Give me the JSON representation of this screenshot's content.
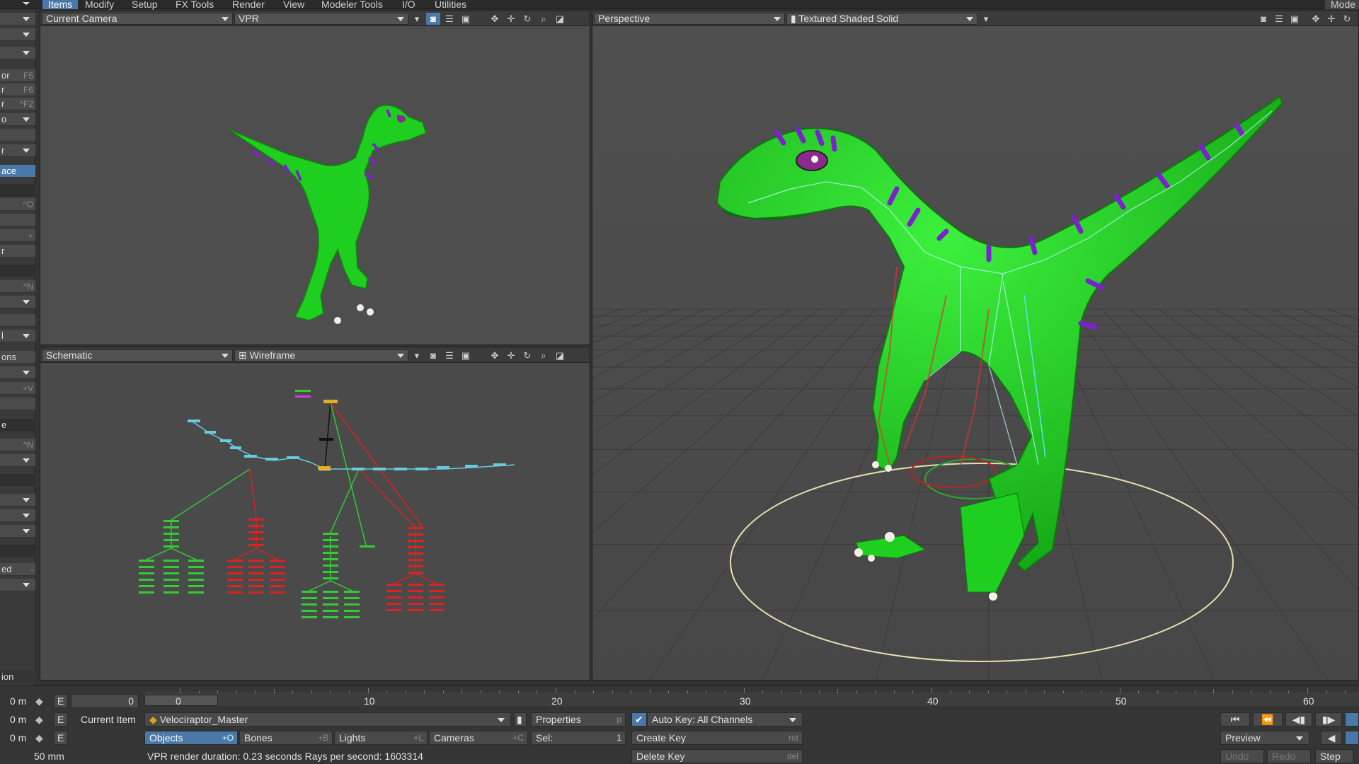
{
  "menu": {
    "tabs": [
      "Items",
      "Modify",
      "Setup",
      "FX Tools",
      "Render",
      "View",
      "Modeler Tools",
      "I/O",
      "Utilities"
    ],
    "active": "Items",
    "right_label": "Mode"
  },
  "left_toolbar": {
    "rows": [
      {
        "text": "",
        "key": ""
      },
      {
        "text": "",
        "key": ""
      },
      {
        "text": "or",
        "key": "F5"
      },
      {
        "text": "r",
        "key": "F6"
      },
      {
        "text": "r",
        "key": "^F2"
      },
      {
        "text": "o",
        "key": ""
      },
      {
        "text": "r",
        "key": ""
      },
      {
        "text": "ace",
        "key": ""
      },
      {
        "text": "",
        "key": "^O"
      },
      {
        "text": "",
        "key": "+"
      },
      {
        "text": "r",
        "key": ""
      },
      {
        "text": "",
        "key": "^N"
      },
      {
        "text": "l",
        "key": ""
      },
      {
        "text": "ons",
        "key": ""
      },
      {
        "text": "",
        "key": "+V"
      },
      {
        "text": "e",
        "key": ""
      },
      {
        "text": "",
        "key": "^N"
      },
      {
        "text": "ed",
        "key": "-"
      },
      {
        "text": "ion",
        "key": ""
      }
    ]
  },
  "vp_top_left": {
    "camera": "Current Camera",
    "renderer": "VPR"
  },
  "vp_bottom_left": {
    "view": "Schematic",
    "shading": "Wireframe"
  },
  "vp_right": {
    "view": "Perspective",
    "shading": "Textured Shaded Solid"
  },
  "timeline": {
    "ticks": [
      "0",
      "10",
      "20",
      "30",
      "40",
      "50",
      "60"
    ],
    "current_frame": "0",
    "frame_field": "0",
    "rows": [
      {
        "pos": "0 m"
      },
      {
        "pos": "0 m"
      },
      {
        "pos": "0 m"
      }
    ],
    "e_label": "E",
    "current_item_label": "Current Item",
    "current_item": "Velociraptor_Master",
    "properties": {
      "label": "Properties",
      "key": "p"
    },
    "auto_key": "Auto Key: All Channels",
    "create_key": {
      "label": "Create Key",
      "key": "ret"
    },
    "delete_key": {
      "label": "Delete Key",
      "key": "del"
    },
    "tabs": [
      {
        "label": "Objects",
        "key": "+O"
      },
      {
        "label": "Bones",
        "key": "+B"
      },
      {
        "label": "Lights",
        "key": "+L"
      },
      {
        "label": "Cameras",
        "key": "+C"
      }
    ],
    "sel_label": "Sel:",
    "sel_value": "1",
    "lens": "50 mm",
    "status": "VPR render duration: 0.23 seconds  Rays per second: 1603314",
    "preview": "Preview",
    "undo": "Undo",
    "redo": "Redo",
    "step": "Step"
  },
  "colors": {
    "accent": "#4a78a8",
    "dino": "#22dd22",
    "stripe": "#7722cc",
    "schematic_green": "#33cc33",
    "schematic_red": "#dd2222",
    "schematic_cyan": "#66ccdd"
  }
}
